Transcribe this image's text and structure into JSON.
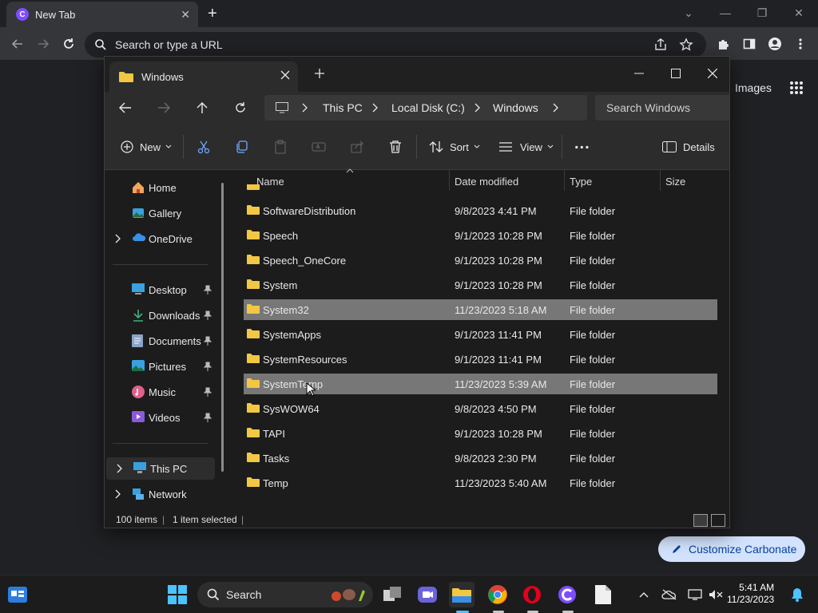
{
  "browser": {
    "tab_title": "New Tab",
    "tab_favicon_letter": "C",
    "omnibox_placeholder": "Search or type a URL",
    "ntp_images_label": "Images",
    "customize_label": "Customize Carbonate"
  },
  "explorer": {
    "tab_title": "Windows",
    "breadcrumb": [
      "This PC",
      "Local Disk (C:)",
      "Windows"
    ],
    "search_placeholder": "Search Windows",
    "toolbar": {
      "new_label": "New",
      "sort_label": "Sort",
      "view_label": "View",
      "more_label": "...",
      "details_label": "Details"
    },
    "sidebar": {
      "top": [
        {
          "label": "Home",
          "icon": "home-icon"
        },
        {
          "label": "Gallery",
          "icon": "gallery-icon"
        },
        {
          "label": "OneDrive",
          "icon": "onedrive-icon"
        }
      ],
      "pinned": [
        {
          "label": "Desktop",
          "icon": "desktop-icon"
        },
        {
          "label": "Downloads",
          "icon": "downloads-icon"
        },
        {
          "label": "Documents",
          "icon": "documents-icon"
        },
        {
          "label": "Pictures",
          "icon": "pictures-icon"
        },
        {
          "label": "Music",
          "icon": "music-icon"
        },
        {
          "label": "Videos",
          "icon": "videos-icon"
        }
      ],
      "bottom": [
        {
          "label": "This PC",
          "icon": "this-pc-icon"
        },
        {
          "label": "Network",
          "icon": "network-icon"
        }
      ]
    },
    "columns": {
      "name": "Name",
      "date": "Date modified",
      "type": "Type",
      "size": "Size"
    },
    "files": [
      {
        "name": "SoftwareDistribution",
        "date": "9/8/2023 4:41 PM",
        "type": "File folder",
        "selected": false
      },
      {
        "name": "Speech",
        "date": "9/1/2023 10:28 PM",
        "type": "File folder",
        "selected": false
      },
      {
        "name": "Speech_OneCore",
        "date": "9/1/2023 10:28 PM",
        "type": "File folder",
        "selected": false
      },
      {
        "name": "System",
        "date": "9/1/2023 10:28 PM",
        "type": "File folder",
        "selected": false
      },
      {
        "name": "System32",
        "date": "11/23/2023 5:18 AM",
        "type": "File folder",
        "selected": true
      },
      {
        "name": "SystemApps",
        "date": "9/1/2023 11:41 PM",
        "type": "File folder",
        "selected": false
      },
      {
        "name": "SystemResources",
        "date": "9/1/2023 11:41 PM",
        "type": "File folder",
        "selected": false
      },
      {
        "name": "SystemTemp",
        "date": "11/23/2023 5:39 AM",
        "type": "File folder",
        "selected": true
      },
      {
        "name": "SysWOW64",
        "date": "9/8/2023 4:50 PM",
        "type": "File folder",
        "selected": false
      },
      {
        "name": "TAPI",
        "date": "9/1/2023 10:28 PM",
        "type": "File folder",
        "selected": false
      },
      {
        "name": "Tasks",
        "date": "9/8/2023 2:30 PM",
        "type": "File folder",
        "selected": false
      },
      {
        "name": "Temp",
        "date": "11/23/2023 5:40 AM",
        "type": "File folder",
        "selected": false
      }
    ],
    "status": {
      "count": "100 items",
      "selection": "1 item selected"
    }
  },
  "taskbar": {
    "search_label": "Search",
    "time": "5:41 AM",
    "date": "11/23/2023"
  },
  "colors": {
    "folder": "#f2c744",
    "selection": "#777777",
    "accent": "#0078d4"
  }
}
